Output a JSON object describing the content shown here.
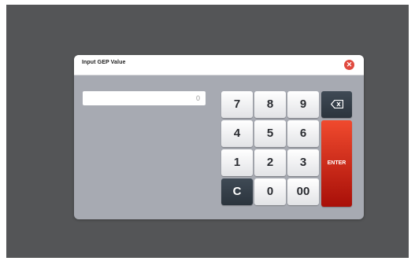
{
  "dialog": {
    "title": "Input GEP Value",
    "close_icon": "close-icon",
    "value": "0"
  },
  "keypad": {
    "row1": [
      "7",
      "8",
      "9"
    ],
    "row2": [
      "4",
      "5",
      "6"
    ],
    "row3": [
      "1",
      "2",
      "3"
    ],
    "row4": [
      "C",
      "0",
      "00"
    ],
    "backspace_icon": "backspace-icon",
    "enter_label": "ENTER"
  },
  "colors": {
    "screen_bg": "#545557",
    "dialog_body": "#a7aab2",
    "enter": "#d9261a",
    "close": "#e04a3f",
    "dark_key": "#34404b"
  }
}
